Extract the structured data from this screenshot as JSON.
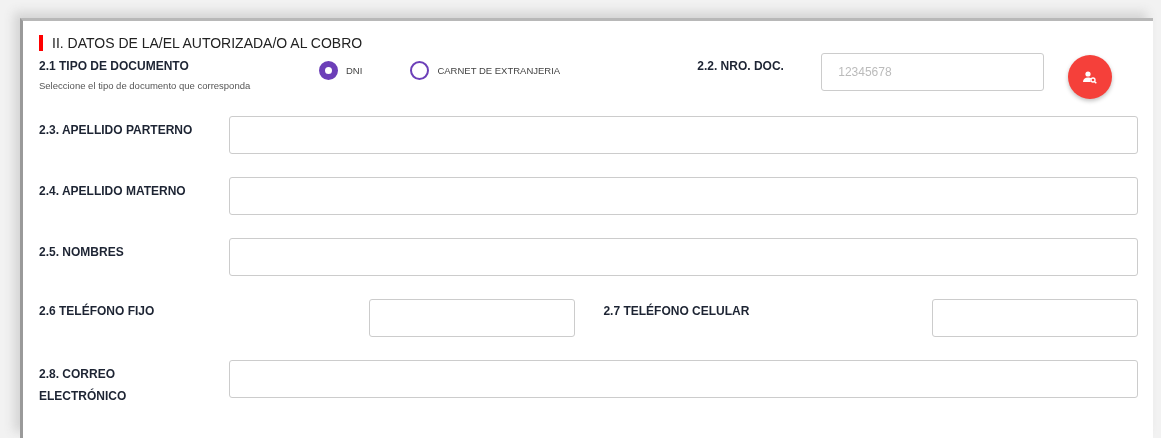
{
  "section_title": "II. DATOS DE LA/EL AUTORIZADA/O AL COBRO",
  "doc_type": {
    "label": "2.1 TIPO DE DOCUMENTO",
    "hint": "Seleccione el tipo de documento que corresponda",
    "options": [
      {
        "label": "DNI",
        "selected": true
      },
      {
        "label": "CARNET DE EXTRANJERIA",
        "selected": false
      }
    ]
  },
  "doc_number": {
    "label": "2.2. NRO. DOC.",
    "placeholder": "12345678"
  },
  "fields": [
    {
      "label": "2.3. APELLIDO PARTERNO"
    },
    {
      "label": "2.4. APELLIDO MATERNO"
    },
    {
      "label": "2.5. NOMBRES"
    }
  ],
  "phones": [
    {
      "label": "2.6 TELÉFONO FIJO"
    },
    {
      "label": "2.7 TELÉFONO CELULAR"
    }
  ],
  "email": {
    "label": "2.8. CORREO ELECTRÓNICO"
  }
}
